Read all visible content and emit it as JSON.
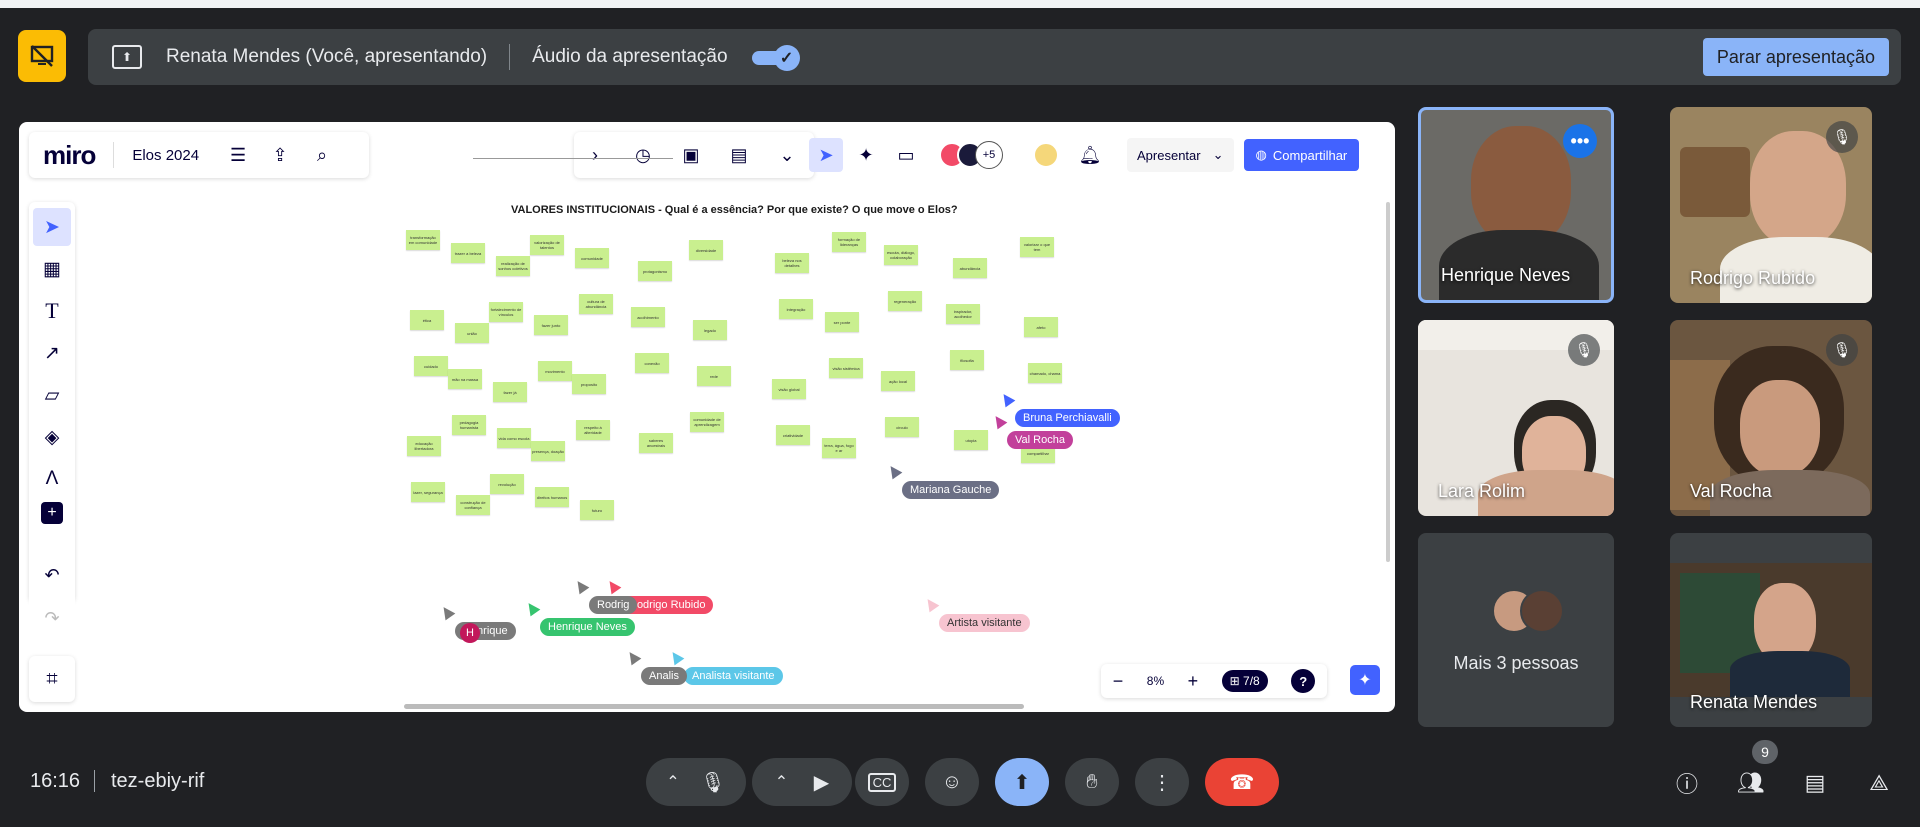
{
  "presenting": {
    "presenter_text": "Renata Mendes (Você, apresentando)",
    "audio_label": "Áudio da apresentação",
    "audio_on": true,
    "stop_label": "Parar apresentação"
  },
  "miro": {
    "logo": "miro",
    "board_name": "Elos 2024",
    "present_label": "Apresentar",
    "share_label": "Compartilhar",
    "collaborators_more": "+5",
    "board_title": "VALORES INSTITUCIONAIS  - Qual é a essência? Por que existe? O que move o Elos?",
    "zoom": "8%",
    "page": "7/8",
    "help": "?",
    "toolbar_icons": [
      "select-icon",
      "templates-icon",
      "text-icon",
      "line-icon",
      "sticky-note-icon",
      "shapes-icon",
      "pen-icon",
      "add-icon"
    ],
    "stickies": [
      "transformação em comunidade",
      "trazer a beleza",
      "realização de sonhos coletivos",
      "valorização de talentos",
      "comunidade",
      "protagonismo",
      "diversidade",
      "beleza nos detalhes",
      "formação de lideranças",
      "escuta, diálogo, colaboração",
      "abundância",
      "valorizar o que tem",
      "ética",
      "união",
      "fortalecimento de vínculos",
      "fazer junto",
      "cultura de abundância",
      "acolhimento",
      "legado",
      "integração",
      "ser ponte",
      "regeneração",
      "inspirador, acolhedor",
      "afeto",
      "cuidado",
      "mão na massa",
      "fazer já",
      "movimento",
      "proposito",
      "conexão",
      "rede",
      "visão global",
      "visão sistêmica",
      "ação local",
      "filosofia",
      "chamado, chama",
      "educação libertadora",
      "pedagogia humanista",
      "vida como escola",
      "presença, doação",
      "respeito à alteridade",
      "saberes ancestrais",
      "comunidade de aprendizagem",
      "criatividade",
      "terra, água, fogo e ar",
      "circulo",
      "utopia",
      "compartilhar",
      "lazer, segurança",
      "construção de confiança",
      "revolução",
      "direitos humanos",
      "futuro"
    ],
    "cursors": [
      {
        "name": "Bruna Perchiavalli",
        "color": "#4262ff"
      },
      {
        "name": "Val Rocha",
        "color": "#c2409b"
      },
      {
        "name": "Mariana Gauche",
        "color": "#6b6f85"
      },
      {
        "name": "Rodrigo Rubido",
        "color": "#f24a67"
      },
      {
        "name": "Henrique Neves",
        "color": "#36c46f"
      },
      {
        "name": "Henrique",
        "color": "#7a7a7a"
      },
      {
        "name": "Rodrig",
        "color": "#7a7a7a"
      },
      {
        "name": "Analista visitante",
        "color": "#5cc7e8"
      },
      {
        "name": "Analis",
        "color": "#7a7a7a"
      },
      {
        "name": "Artista visitante",
        "color": "#f7c4d0"
      }
    ],
    "avatar_initial": "H"
  },
  "participants": [
    {
      "name": "Henrique Neves",
      "muted": false,
      "speaking": true
    },
    {
      "name": "Rodrigo Rubido",
      "muted": true
    },
    {
      "name": "Lara Rolim",
      "muted": true
    },
    {
      "name": "Val Rocha",
      "muted": true
    },
    {
      "name": "Renata Mendes",
      "muted": false
    }
  ],
  "more_people_label": "Mais 3 pessoas",
  "bottom": {
    "time": "16:16",
    "meeting_code": "tez-ebiy-rif",
    "people_count": "9"
  },
  "colors": {
    "background": "#202124",
    "accent": "#8ab4f8",
    "end_call": "#ea4335",
    "sticky": "#c9ef8f",
    "miro_blue": "#4262ff"
  }
}
